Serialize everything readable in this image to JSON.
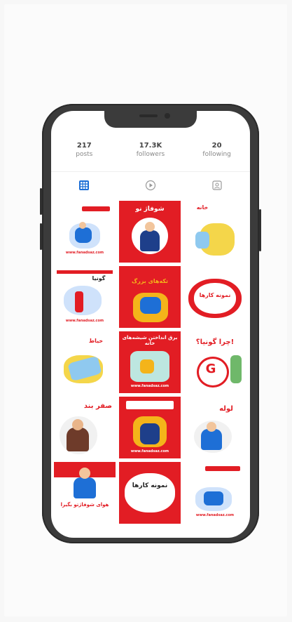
{
  "profile": {
    "stats": [
      {
        "num": "217",
        "label": "posts"
      },
      {
        "num": "17.3K",
        "label": "followers"
      },
      {
        "num": "20",
        "label": "following"
      }
    ]
  },
  "tabs": [
    {
      "icon": "grid-icon",
      "active": true
    },
    {
      "icon": "reels-icon",
      "active": false
    },
    {
      "icon": "tagged-icon",
      "active": false
    }
  ],
  "posts": [
    {
      "theme": "white",
      "headline": "",
      "url": "www.fanadsaz.com"
    },
    {
      "theme": "red",
      "headline": "شوفاژ نو",
      "url": ""
    },
    {
      "theme": "white",
      "headline": "خانه",
      "url": ""
    },
    {
      "theme": "white",
      "headline": "گونیا",
      "url": "www.fanadsaz.com"
    },
    {
      "theme": "red",
      "headline": "تکه‌های بزرگ",
      "url": ""
    },
    {
      "theme": "white",
      "headline": "نمونه کارها",
      "url": ""
    },
    {
      "theme": "white",
      "headline": "خیاط",
      "url": ""
    },
    {
      "theme": "red",
      "headline": "برق انداختن شیشه‌های خانه",
      "url": "www.fanadsaz.com"
    },
    {
      "theme": "white",
      "headline": "چرا گونیا؟!",
      "url": ""
    },
    {
      "theme": "white",
      "headline": "صفر بند",
      "url": ""
    },
    {
      "theme": "red",
      "headline": "",
      "url": "www.fanadsaz.com"
    },
    {
      "theme": "white",
      "headline": "لوله",
      "url": ""
    },
    {
      "theme": "white",
      "headline": "هوای شوفاژتو بگیرا",
      "url": ""
    },
    {
      "theme": "red",
      "headline": "نمونه کارها",
      "url": ""
    },
    {
      "theme": "white",
      "headline": "",
      "url": "www.fanadsaz.com"
    }
  ],
  "colors": {
    "brand_red": "#e21d24",
    "accent_blue": "#1e6fd6",
    "accent_yellow": "#f4b41a"
  }
}
